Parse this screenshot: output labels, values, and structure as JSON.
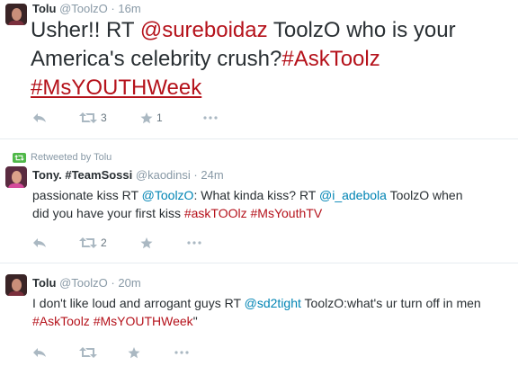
{
  "tweets": [
    {
      "name": "Tolu",
      "handle": "@ToolzO",
      "sep": "·",
      "time": "16m",
      "text_a": "Usher!! RT ",
      "mention": "@sureboidaz",
      "text_b": " ToolzO who is your America's celebrity crush?",
      "tag1": "#AskToolz",
      "tag2": "#MsYOUTHWeek",
      "retweets": "3",
      "favorites": "1"
    },
    {
      "retweeted_by": "Retweeted by Tolu",
      "name": "Tony. #TeamSossi",
      "handle": "@kaodinsi",
      "sep": "·",
      "time": "24m",
      "text_a": "passionate kiss RT ",
      "mention1": "@ToolzO",
      "text_b": ": What kinda kiss? RT ",
      "mention2": "@i_adebola",
      "text_c": " ToolzO when did you have your first kiss ",
      "tag1": "#askTOOlz",
      "tag2": "#MsYouthTV",
      "retweets": "2"
    },
    {
      "name": "Tolu",
      "handle": "@ToolzO",
      "sep": "·",
      "time": "20m",
      "text_a": "I don't like loud and arrogant guys RT ",
      "mention": "@sd2tight",
      "text_b": "  ToolzO:what's ur turn off in men ",
      "tag1": "#AskToolz",
      "tag2": "#MsYOUTHWeek",
      "text_c": "\""
    }
  ],
  "icons": {
    "reply": "reply-icon",
    "retweet": "retweet-icon",
    "favorite": "star-icon",
    "more": "more-icon"
  },
  "colors": {
    "link": "#0084b4",
    "hashtag": "#b5121b",
    "muted": "#8899a6",
    "icon": "#aab8c2"
  }
}
